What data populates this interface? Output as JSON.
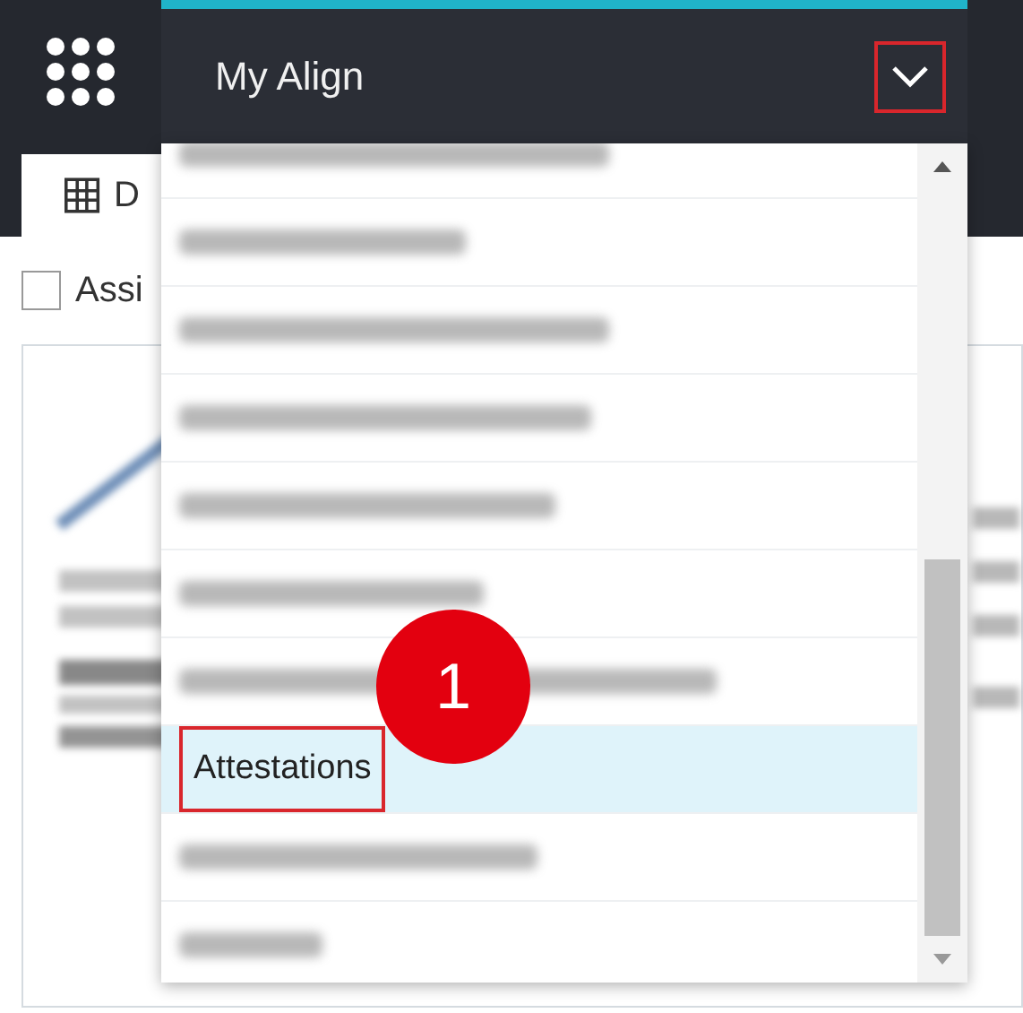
{
  "header": {
    "title": "My Align",
    "expanded": true,
    "annotated": true
  },
  "tab": {
    "label": "D",
    "selected": true
  },
  "filter": {
    "label": "Assi",
    "checked": false
  },
  "menu": {
    "items": [
      {
        "kind": "blurred",
        "selected": false
      },
      {
        "kind": "blurred",
        "selected": false
      },
      {
        "kind": "blurred",
        "selected": false
      },
      {
        "kind": "blurred",
        "selected": false
      },
      {
        "kind": "blurred",
        "selected": false
      },
      {
        "kind": "blurred",
        "selected": false
      },
      {
        "kind": "blurred",
        "selected": false
      },
      {
        "kind": "text",
        "label": "Attestations",
        "selected": true,
        "annotated": true
      },
      {
        "kind": "blurred",
        "selected": false
      },
      {
        "kind": "blurred",
        "selected": false
      }
    ]
  },
  "step_badge": "1"
}
